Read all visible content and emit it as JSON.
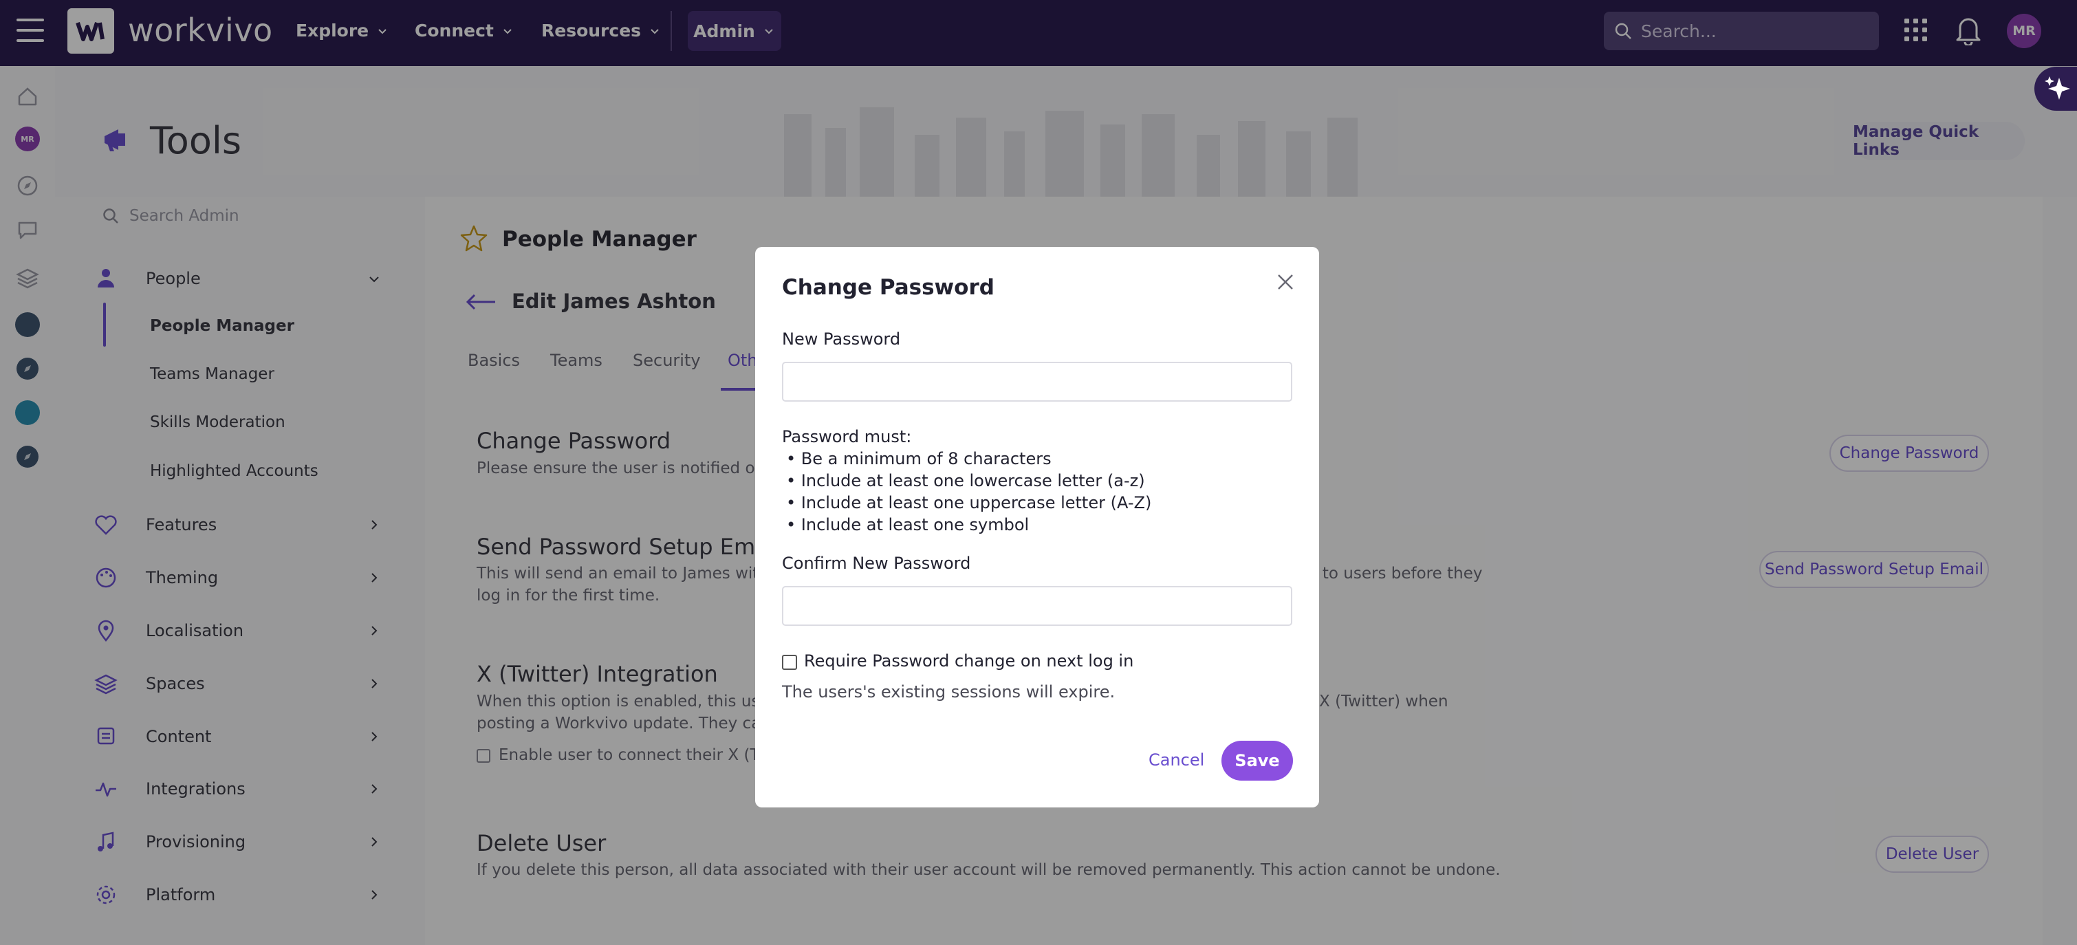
{
  "topbar": {
    "logo_text": "workvivo",
    "nav": [
      {
        "label": "Explore"
      },
      {
        "label": "Connect"
      },
      {
        "label": "Resources"
      }
    ],
    "admin_label": "Admin",
    "search_placeholder": "Search...",
    "avatar_initials": "MR"
  },
  "rail": {
    "avatar_initials": "MR",
    "icons": [
      "home-icon",
      "avatar",
      "compass-icon",
      "chat-icon",
      "layers-icon",
      "space-avatar",
      "compass-icon",
      "space-avatar",
      "compass-icon"
    ]
  },
  "header": {
    "title": "Tools",
    "quick_links_label": "Manage Quick Links"
  },
  "sidebar": {
    "search_placeholder": "Search Admin",
    "items": [
      {
        "label": "People",
        "icon": "person-icon",
        "expanded": true,
        "children": [
          "People Manager",
          "Teams Manager",
          "Skills Moderation",
          "Highlighted Accounts"
        ]
      },
      {
        "label": "Features",
        "icon": "heart-icon"
      },
      {
        "label": "Theming",
        "icon": "palette-icon"
      },
      {
        "label": "Localisation",
        "icon": "pin-icon"
      },
      {
        "label": "Spaces",
        "icon": "layers-icon"
      },
      {
        "label": "Content",
        "icon": "content-icon"
      },
      {
        "label": "Integrations",
        "icon": "pulse-icon"
      },
      {
        "label": "Provisioning",
        "icon": "music-icon"
      },
      {
        "label": "Platform",
        "icon": "gear-icon"
      }
    ]
  },
  "main": {
    "title": "People Manager",
    "edit_title": "Edit James Ashton",
    "tabs": [
      "Basics",
      "Teams",
      "Security",
      "Oth"
    ],
    "sections": {
      "change_password": {
        "title": "Change Password",
        "desc": "Please ensure the user is notified of th",
        "button": "Change Password"
      },
      "setup_email": {
        "title": "Send Password Setup Email",
        "desc_1a": "This will send an email to James with a",
        "desc_1b": "nt to users before they",
        "desc_2": "log in for the first time.",
        "button": "Send Password Setup Email"
      },
      "twitter": {
        "title": "X (Twitter) Integration",
        "desc_1a": "When this option is enabled, this user",
        "desc_1b": "X (Twitter) when",
        "desc_2": "posting a Workvivo update. They can a",
        "checkbox_label": "Enable user to connect their X (Twit"
      },
      "delete": {
        "title": "Delete User",
        "desc": "If you delete this person, all data associated with their user account will be removed permanently. This action cannot be undone.",
        "button": "Delete User"
      }
    }
  },
  "modal": {
    "title": "Change Password",
    "new_password_label": "New Password",
    "rules_title": "Password must:",
    "rules": [
      "• Be a minimum of 8 characters",
      "• Include at least one lowercase letter (a-z)",
      "• Include at least one uppercase letter (A-Z)",
      "• Include at least one symbol"
    ],
    "confirm_label": "Confirm New Password",
    "require_change_label": "Require Password change on next log in",
    "require_change_checked": false,
    "sessions_note": "The users's existing sessions will expire.",
    "cancel_label": "Cancel",
    "save_label": "Save",
    "accent": "#8b4fe0"
  }
}
